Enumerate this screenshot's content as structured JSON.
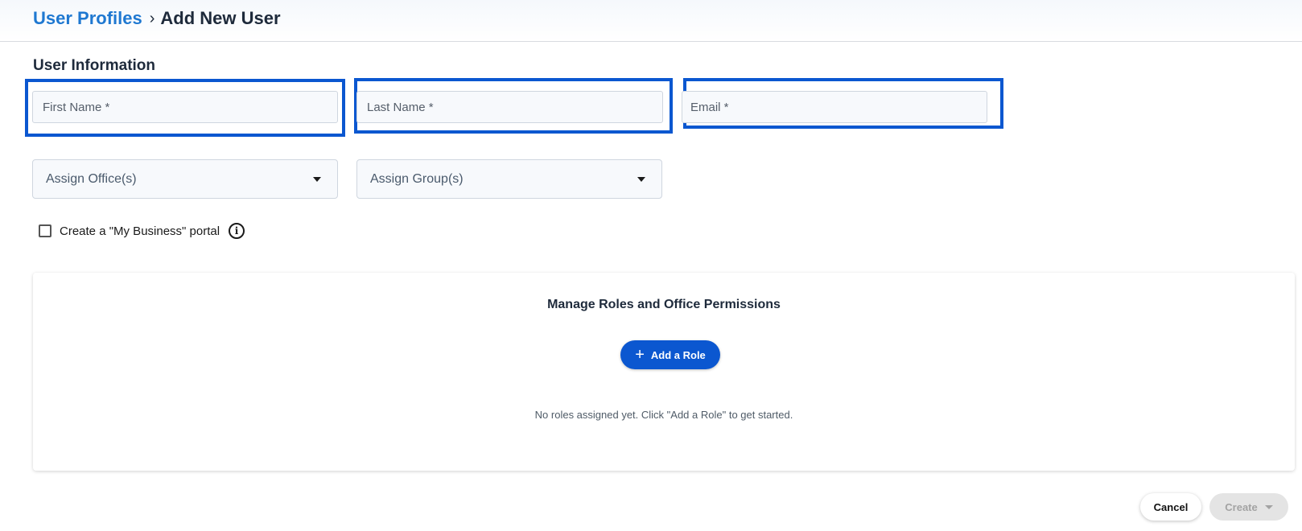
{
  "breadcrumb": {
    "parent": "User Profiles",
    "separator": "›",
    "current": "Add New User"
  },
  "user_info": {
    "title": "User Information",
    "first_name_placeholder": "First Name *",
    "last_name_placeholder": "Last Name *",
    "email_placeholder": "Email *",
    "first_name_value": "",
    "last_name_value": "",
    "email_value": ""
  },
  "selects": {
    "offices_label": "Assign Office(s)",
    "groups_label": "Assign Group(s)",
    "caret_icon": "caret-down-icon"
  },
  "portal": {
    "checkbox_label": "Create a \"My Business\" portal",
    "checked": false,
    "info_icon_glyph": "i"
  },
  "roles": {
    "title": "Manage Roles and Office Permissions",
    "add_role_label": "Add a Role",
    "add_icon_glyph": "+",
    "empty_message": "No roles assigned yet. Click \"Add a Role\" to get started."
  },
  "actions": {
    "cancel_label": "Cancel",
    "create_label": "Create",
    "create_enabled": false
  },
  "colors": {
    "accent": "#0b57d0",
    "link": "#1f78d1",
    "highlight_border": "#0b57d0"
  }
}
